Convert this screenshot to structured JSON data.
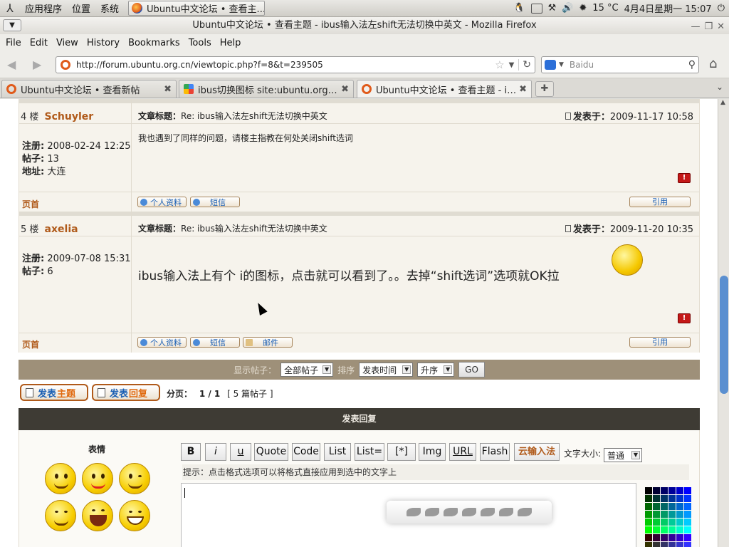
{
  "panel": {
    "menus": [
      "应用程序",
      "位置",
      "系统"
    ],
    "task": "Ubuntu中文论坛 • 查看主...",
    "temperature": "15 °C",
    "clock": "4月4日星期一 15:07"
  },
  "window": {
    "title": "Ubuntu中文论坛 • 查看主题 - ibus输入法左shift无法切换中英文 - Mozilla Firefox"
  },
  "menubar": [
    "File",
    "Edit",
    "View",
    "History",
    "Bookmarks",
    "Tools",
    "Help"
  ],
  "nav": {
    "url": "http://forum.ubuntu.org.cn/viewtopic.php?f=8&t=239505",
    "search_placeholder": "Baidu"
  },
  "tabs": [
    {
      "label": "Ubuntu中文论坛 • 查看新帖"
    },
    {
      "label": "ibus切换图标 site:ubuntu.org.cn..."
    },
    {
      "label": "Ubuntu中文论坛 • 查看主题 - ib..."
    }
  ],
  "posts": [
    {
      "floor": "4 楼",
      "user": "Schuyler",
      "subject_label": "文章标题：",
      "subject": "Re: ibus输入法左shift无法切换中英文",
      "posted_label": "发表于：",
      "posted": "2009-11-17 10:58",
      "reg_label": "注册:",
      "reg": "2008-02-24 12:25",
      "posts_label": "帖子:",
      "post_count": "13",
      "loc_label": "地址:",
      "loc": "大连",
      "body": "我也遇到了同样的问题，请楼主指教在何处关闭shift选词",
      "top": "页首",
      "btn_profile": "个人资料",
      "btn_pm": "短信",
      "btn_quote": "引用"
    },
    {
      "floor": "5 楼",
      "user": "axelia",
      "subject_label": "文章标题：",
      "subject": "Re: ibus输入法左shift无法切换中英文",
      "posted_label": "发表于：",
      "posted": "2009-11-20 10:35",
      "reg_label": "注册:",
      "reg": "2009-07-08 15:31",
      "posts_label": "帖子:",
      "post_count": "6",
      "body": "ibus输入法上有个 i的图标，点击就可以看到了。。去掉“shift选词”选项就OK拉",
      "top": "页首",
      "btn_profile": "个人资料",
      "btn_pm": "短信",
      "btn_mail": "邮件",
      "btn_quote": "引用"
    }
  ],
  "sortbar": {
    "show_label": "显示帖子：",
    "show_value": "全部帖子",
    "sort_label": "排序",
    "sort_value": "发表时间",
    "order_value": "升序",
    "go": "GO"
  },
  "actions": {
    "new_topic_a": "发表",
    "new_topic_b": "主题",
    "reply_a": "发表",
    "reply_b": "回复",
    "pager_label": "分页：",
    "pager": "1 / 1",
    "total": "[ 5 篇帖子 ]"
  },
  "reply": {
    "header": "发表回复",
    "emoticons_label": "表情",
    "buttons": [
      "B",
      "i",
      "u",
      "Quote",
      "Code",
      "List",
      "List=",
      "[*]",
      "Img",
      "URL",
      "Flash",
      "云输入法"
    ],
    "size_label": "文字大小:",
    "size_value": "普通",
    "hint": "提示：点击格式选项可以将格式直接应用到选中的文字上"
  },
  "colors": {
    "username": "#b05a1a",
    "sortbar": "#9e9079",
    "reply_header": "#3e3b34",
    "link": "#1a5fb4"
  }
}
